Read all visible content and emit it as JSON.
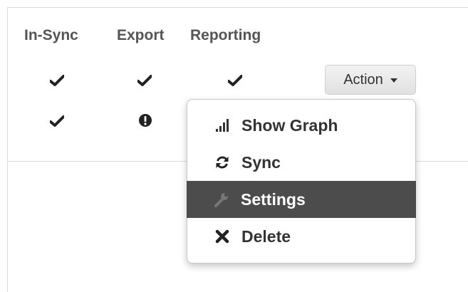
{
  "table": {
    "columns": [
      "In-Sync",
      "Export",
      "Reporting"
    ],
    "rows": [
      {
        "in_sync": "check-icon",
        "export": "check-icon",
        "reporting": "check-icon"
      },
      {
        "in_sync": "check-icon",
        "export": "exclamation-circle-icon",
        "reporting": "hidden-by-menu"
      }
    ]
  },
  "action": {
    "label": "Action",
    "icon": "caret-down-icon"
  },
  "menu": {
    "items": [
      {
        "label": "Show Graph",
        "icon": "signal-bars-icon",
        "active": false
      },
      {
        "label": "Sync",
        "icon": "refresh-icon",
        "active": false
      },
      {
        "label": "Settings",
        "icon": "wrench-icon",
        "active": true
      },
      {
        "label": "Delete",
        "icon": "close-icon",
        "active": false
      }
    ]
  },
  "colors": {
    "menu_active_bg": "#4c4c4c",
    "menu_active_text": "#ffffff",
    "text": "#333333",
    "header_text": "#555555"
  }
}
